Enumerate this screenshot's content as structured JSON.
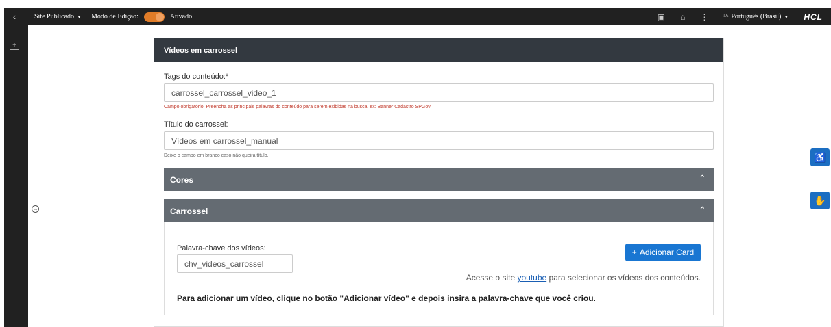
{
  "topbar": {
    "back_icon": "chevron-left-icon",
    "site_status": "Site Publicado",
    "edit_mode_label": "Modo de Edição:",
    "edit_mode_value": "Ativado",
    "toggle_color": "#e07c28",
    "language": "Português (Brasil)",
    "brand": "HCL"
  },
  "card": {
    "title": "Vídeos em carrossel",
    "tags_label": "Tags do conteúdo:*",
    "tags_value": "carrossel_carrossel_video_1",
    "tags_help": "Campo obrigatório. Preencha as principais palavras do conteúdo para serem exibidas na busca. ex: Banner Cadastro SPGov",
    "title_label": "Título do carrossel:",
    "title_value": "Vídeos em carrossel_manual",
    "title_help": "Deixe o campo em branco caso não queira título.",
    "accordions": {
      "cores": "Cores",
      "carrossel": "Carrossel"
    },
    "carrossel": {
      "keyword_label": "Palavra-chave dos vídeos:",
      "keyword_value": "chv_videos_carrossel",
      "add_button": "Adicionar Card",
      "info_prefix": "Acesse o site",
      "info_link": "youtube",
      "info_suffix": "para selecionar os vídeos dos conteúdos.",
      "instruction": "Para adicionar um vídeo, clique no botão \"Adicionar vídeo\" e depois insira a palavra-chave que você criou."
    }
  },
  "colors": {
    "header": "#333940",
    "accordion": "#646b72",
    "primary": "#1976d2",
    "error": "#c0392b"
  }
}
